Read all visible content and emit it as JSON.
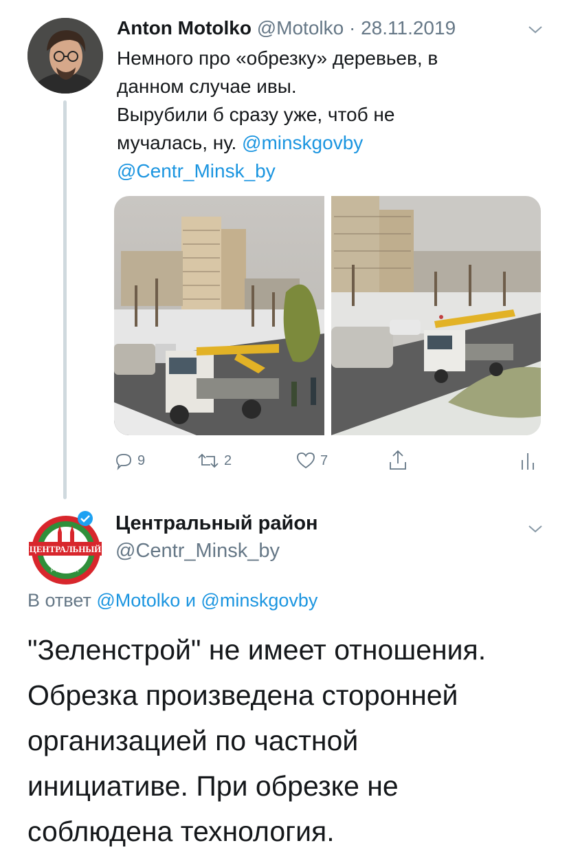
{
  "tweet1": {
    "author_name": "Anton Motolko",
    "author_handle": "@Motolko",
    "separator": "·",
    "date": "28.11.2019",
    "text_lines": [
      "Немного про «обрезку» деревьев, в",
      "данном случае ивы.",
      "Вырубили б сразу уже, чтоб не",
      "мучалась, ну."
    ],
    "mention_1": "@minskgovby",
    "mention_2": "@Centr_Minsk_by",
    "actions": {
      "reply_count": "9",
      "retweet_count": "2",
      "like_count": "7"
    }
  },
  "tweet2": {
    "author_name": "Центральный район",
    "author_handle": "@Centr_Minsk_by",
    "avatar_text": "ЦЕНТРАЛЬНЫЙ",
    "avatar_subtext": "РАЙОН",
    "reply_prefix": "В ответ",
    "reply_user_1": "@Motolko",
    "reply_joiner": "и",
    "reply_user_2": "@minskgovby",
    "text_lines": [
      "\"Зеленстрой\" не имеет отношения.",
      "Обрезка произведена сторонней",
      "организацией по частной",
      "инициативе. При обрезке не",
      "соблюдена технология."
    ]
  },
  "icons": {
    "reply": "reply-icon",
    "retweet": "retweet-icon",
    "like": "heart-icon",
    "share": "share-icon",
    "analytics": "analytics-icon",
    "menu": "chevron-down-icon",
    "verified": "verified-badge-icon"
  },
  "colors": {
    "link": "#1b95e0",
    "secondary_text": "#657786",
    "thread_line": "#cfd9de",
    "verified": "#1da1f2"
  }
}
